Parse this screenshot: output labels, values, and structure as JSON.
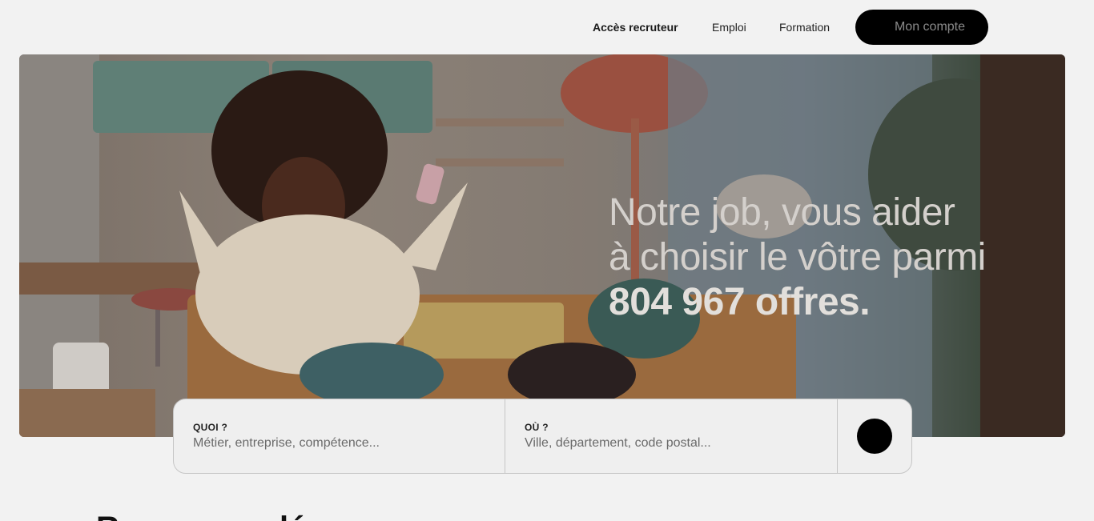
{
  "nav": {
    "recruiter": "Accès recruteur",
    "jobs": "Emploi",
    "training": "Formation",
    "account": "Mon compte"
  },
  "hero": {
    "line1": "Notre job, vous aider",
    "line2": "à choisir le vôtre parmi",
    "line3": "804 967 offres."
  },
  "search": {
    "what_label": "QUOI ?",
    "what_placeholder": "Métier, entreprise, compétence...",
    "where_label": "OÙ ?",
    "where_placeholder": "Ville, département, code postal...",
    "button_icon": "search-icon"
  },
  "section": {
    "heading": "Recommandé pour vous"
  }
}
